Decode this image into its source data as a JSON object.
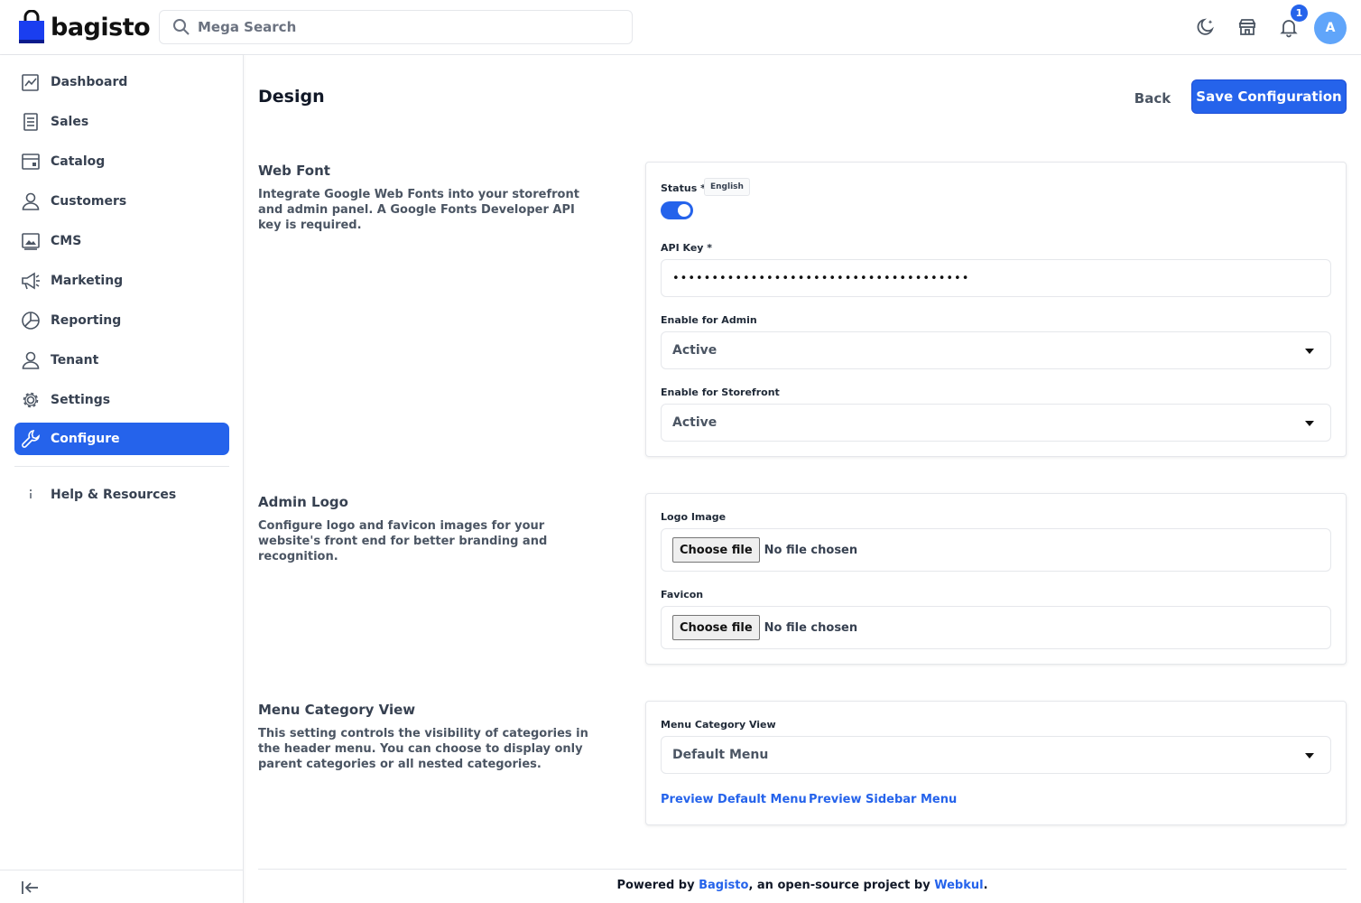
{
  "header": {
    "brand": "bagisto",
    "search_placeholder": "Mega Search",
    "notification_count": "1",
    "avatar_initial": "A"
  },
  "sidebar": {
    "items": [
      {
        "label": "Dashboard",
        "icon": "dashboard-icon"
      },
      {
        "label": "Sales",
        "icon": "sales-icon"
      },
      {
        "label": "Catalog",
        "icon": "catalog-icon"
      },
      {
        "label": "Customers",
        "icon": "customers-icon"
      },
      {
        "label": "CMS",
        "icon": "cms-icon"
      },
      {
        "label": "Marketing",
        "icon": "marketing-icon"
      },
      {
        "label": "Reporting",
        "icon": "reporting-icon"
      },
      {
        "label": "Tenant",
        "icon": "tenant-icon"
      },
      {
        "label": "Settings",
        "icon": "settings-icon"
      },
      {
        "label": "Configure",
        "icon": "configure-icon",
        "active": true
      }
    ],
    "help_label": "Help & Resources"
  },
  "page": {
    "title": "Design",
    "back_label": "Back",
    "save_label": "Save Configuration"
  },
  "web_font": {
    "title": "Web Font",
    "description": "Integrate Google Web Fonts into your storefront and admin panel. A Google Fonts Developer API key is required.",
    "status_label": "Status *",
    "locale_chip": "English",
    "status_enabled": true,
    "api_key_label": "API Key *",
    "api_key_value": "••••••••••••••••••••••••••••••••••••••",
    "enable_admin_label": "Enable for Admin",
    "enable_admin_value": "Active",
    "enable_storefront_label": "Enable for Storefront",
    "enable_storefront_value": "Active"
  },
  "admin_logo": {
    "title": "Admin Logo",
    "description": "Configure logo and favicon images for your website's front end for better branding and recognition.",
    "logo_label": "Logo Image",
    "favicon_label": "Favicon",
    "choose_file_label": "Choose file",
    "no_file_text": "No file chosen"
  },
  "menu_category": {
    "title": "Menu Category View",
    "description": "This setting controls the visibility of categories in the header menu. You can choose to display only parent categories or all nested categories.",
    "field_label": "Menu Category View",
    "field_value": "Default Menu",
    "preview_default": "Preview Default Menu",
    "preview_sidebar": "Preview Sidebar Menu"
  },
  "footer": {
    "prefix": "Powered by ",
    "bagisto": "Bagisto",
    "middle": ", an open-source project by ",
    "webkul": "Webkul",
    "suffix": "."
  },
  "colors": {
    "accent": "#2563eb",
    "text": "#1f2937",
    "border": "#e5e7eb"
  }
}
